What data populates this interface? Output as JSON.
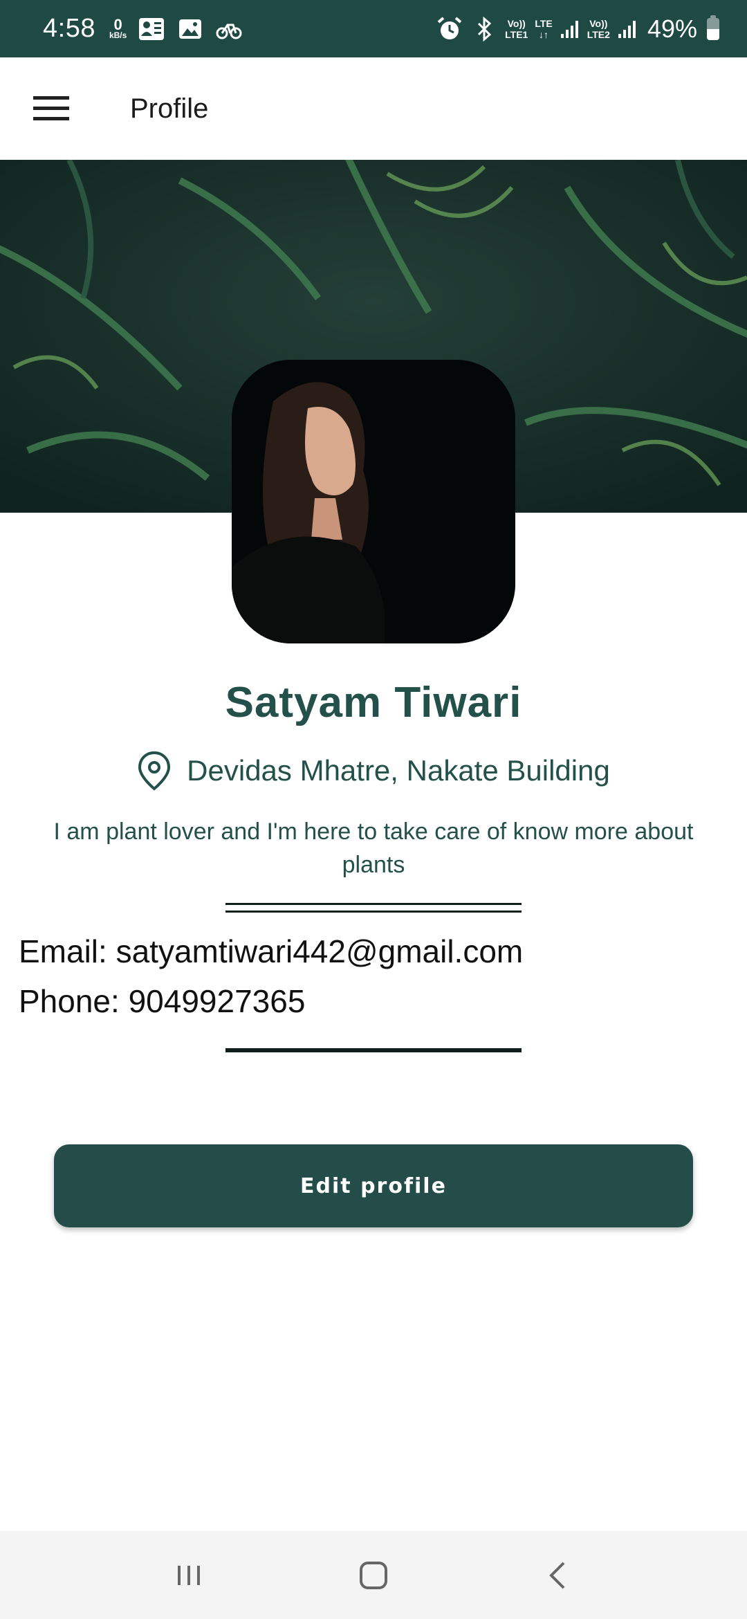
{
  "status_bar": {
    "time": "4:58",
    "data_rate_value": "0",
    "data_rate_unit": "kB/s",
    "sim1_top": "Vo))",
    "sim1_bottom": "LTE1",
    "lte_label": "LTE",
    "sim2_top": "Vo))",
    "sim2_bottom": "LTE2",
    "battery_percent": "49%",
    "battery_level": 0.49,
    "icons": [
      "gallery-contacts-icon",
      "image-icon",
      "bike-icon",
      "alarm-icon",
      "bluetooth-icon",
      "signal-icon"
    ]
  },
  "app_bar": {
    "title": "Profile",
    "menu_icon": "hamburger-menu-icon"
  },
  "colors": {
    "status_bar": "#1f4a44",
    "accent": "#24504a",
    "button": "#244c48"
  },
  "profile": {
    "name": "Satyam Tiwari",
    "location": "Devidas Mhatre, Nakate Building",
    "bio": "I am plant lover and I'm here to take care of know more about plants",
    "email_line": "Email: satyamtiwari442@gmail.com",
    "phone_line": "Phone: 9049927365"
  },
  "actions": {
    "edit_label": "Edit profile"
  },
  "nav_bar": {
    "icons": [
      "recent-apps-icon",
      "home-icon",
      "back-icon"
    ]
  }
}
